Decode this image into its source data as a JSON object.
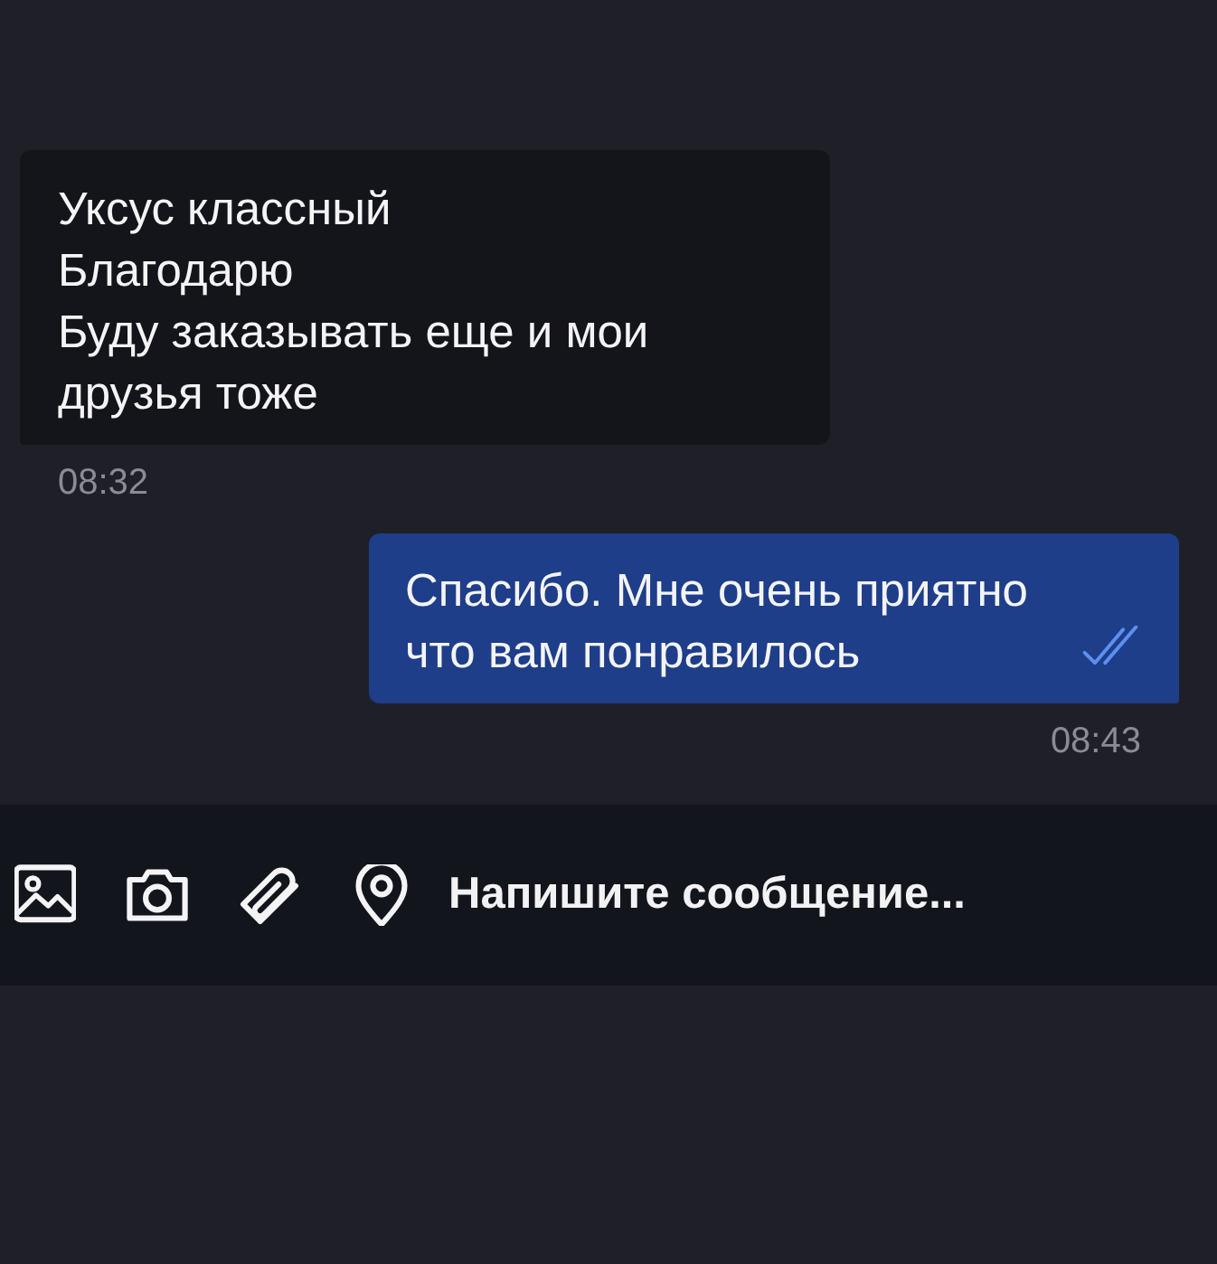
{
  "messages": [
    {
      "kind": "incoming",
      "text": "Уксус классный\nБлагодарю\nБуду заказывать еще и мои друзья тоже",
      "time": "08:32"
    },
    {
      "kind": "outgoing",
      "text": "Спасибо. Мне очень приятно что вам понравилось",
      "time": "08:43",
      "read": true
    }
  ],
  "composer": {
    "placeholder": "Напишите сообщение..."
  }
}
